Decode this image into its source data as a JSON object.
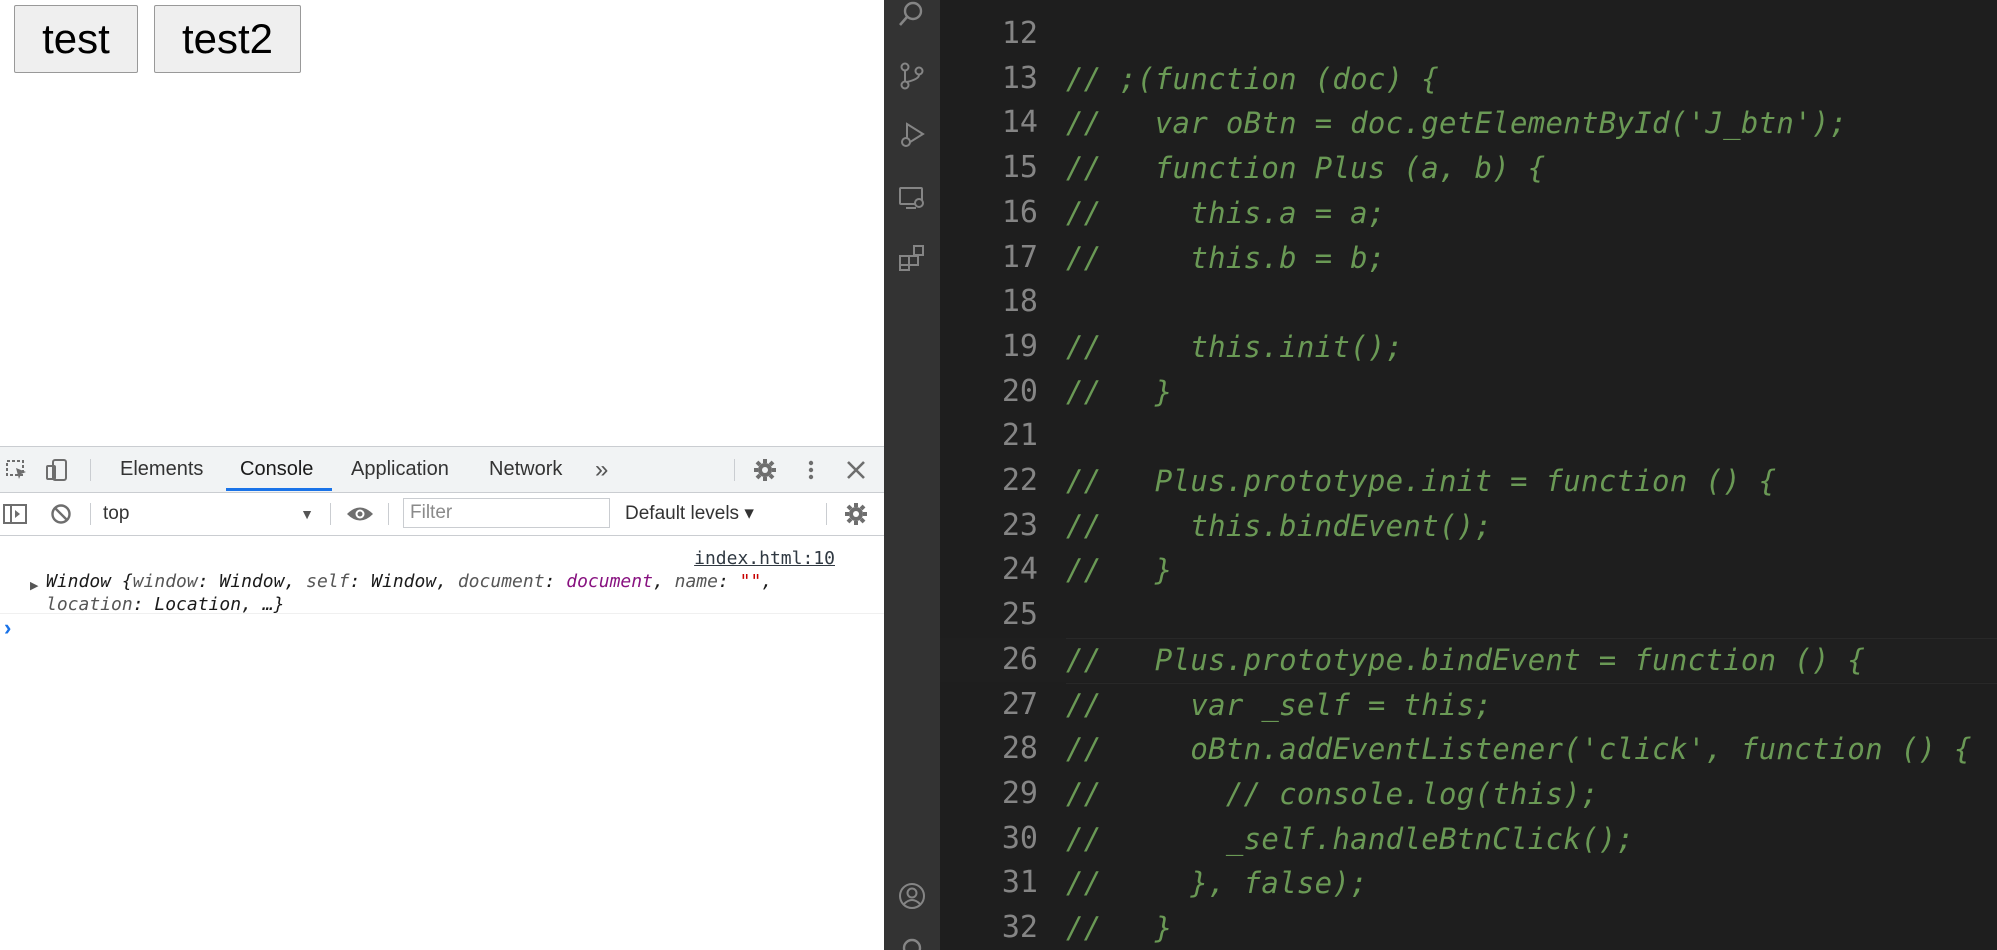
{
  "page": {
    "buttons": [
      "test",
      "test2"
    ]
  },
  "devtools": {
    "tabs": [
      "Elements",
      "Console",
      "Application",
      "Network"
    ],
    "active_tab": "Console",
    "more_tabs": "»",
    "context": "top",
    "filter_placeholder": "Filter",
    "levels": "Default levels ▾",
    "log": {
      "source": "index.html:10",
      "line1_prefix": "Window {",
      "k_window": "window",
      "v_window": ": Window, ",
      "k_self": "self",
      "v_self": ": Window, ",
      "k_document": "document",
      "v_document_sep": ": ",
      "v_document": "document",
      "comma1": ", ",
      "k_name": "name",
      "v_name_sep": ": ",
      "v_name": "\"\"",
      "comma2": ",",
      "k_location": "location",
      "v_location": ": Location, …}"
    },
    "prompt": "›"
  },
  "editor": {
    "lines": [
      {
        "num": "12",
        "text": ""
      },
      {
        "num": "13",
        "text": "// ;(function (doc) {"
      },
      {
        "num": "14",
        "text": "//   var oBtn = doc.getElementById('J_btn');"
      },
      {
        "num": "15",
        "text": "//   function Plus (a, b) {"
      },
      {
        "num": "16",
        "text": "//     this.a = a;"
      },
      {
        "num": "17",
        "text": "//     this.b = b;"
      },
      {
        "num": "18",
        "text": ""
      },
      {
        "num": "19",
        "text": "//     this.init();"
      },
      {
        "num": "20",
        "text": "//   }"
      },
      {
        "num": "21",
        "text": ""
      },
      {
        "num": "22",
        "text": "//   Plus.prototype.init = function () {"
      },
      {
        "num": "23",
        "text": "//     this.bindEvent();"
      },
      {
        "num": "24",
        "text": "//   }"
      },
      {
        "num": "25",
        "text": ""
      },
      {
        "num": "26",
        "text": "//   Plus.prototype.bindEvent = function () {"
      },
      {
        "num": "27",
        "text": "//     var _self = this;"
      },
      {
        "num": "28",
        "text": "//     oBtn.addEventListener('click', function () {"
      },
      {
        "num": "29",
        "text": "//       // console.log(this);"
      },
      {
        "num": "30",
        "text": "//       _self.handleBtnClick();"
      },
      {
        "num": "31",
        "text": "//     }, false);"
      },
      {
        "num": "32",
        "text": "//   }"
      }
    ],
    "current_line": "26",
    "activity_icons": [
      "search-icon",
      "source-control-icon",
      "run-debug-icon",
      "remote-explorer-icon",
      "extensions-icon",
      "account-icon"
    ]
  }
}
